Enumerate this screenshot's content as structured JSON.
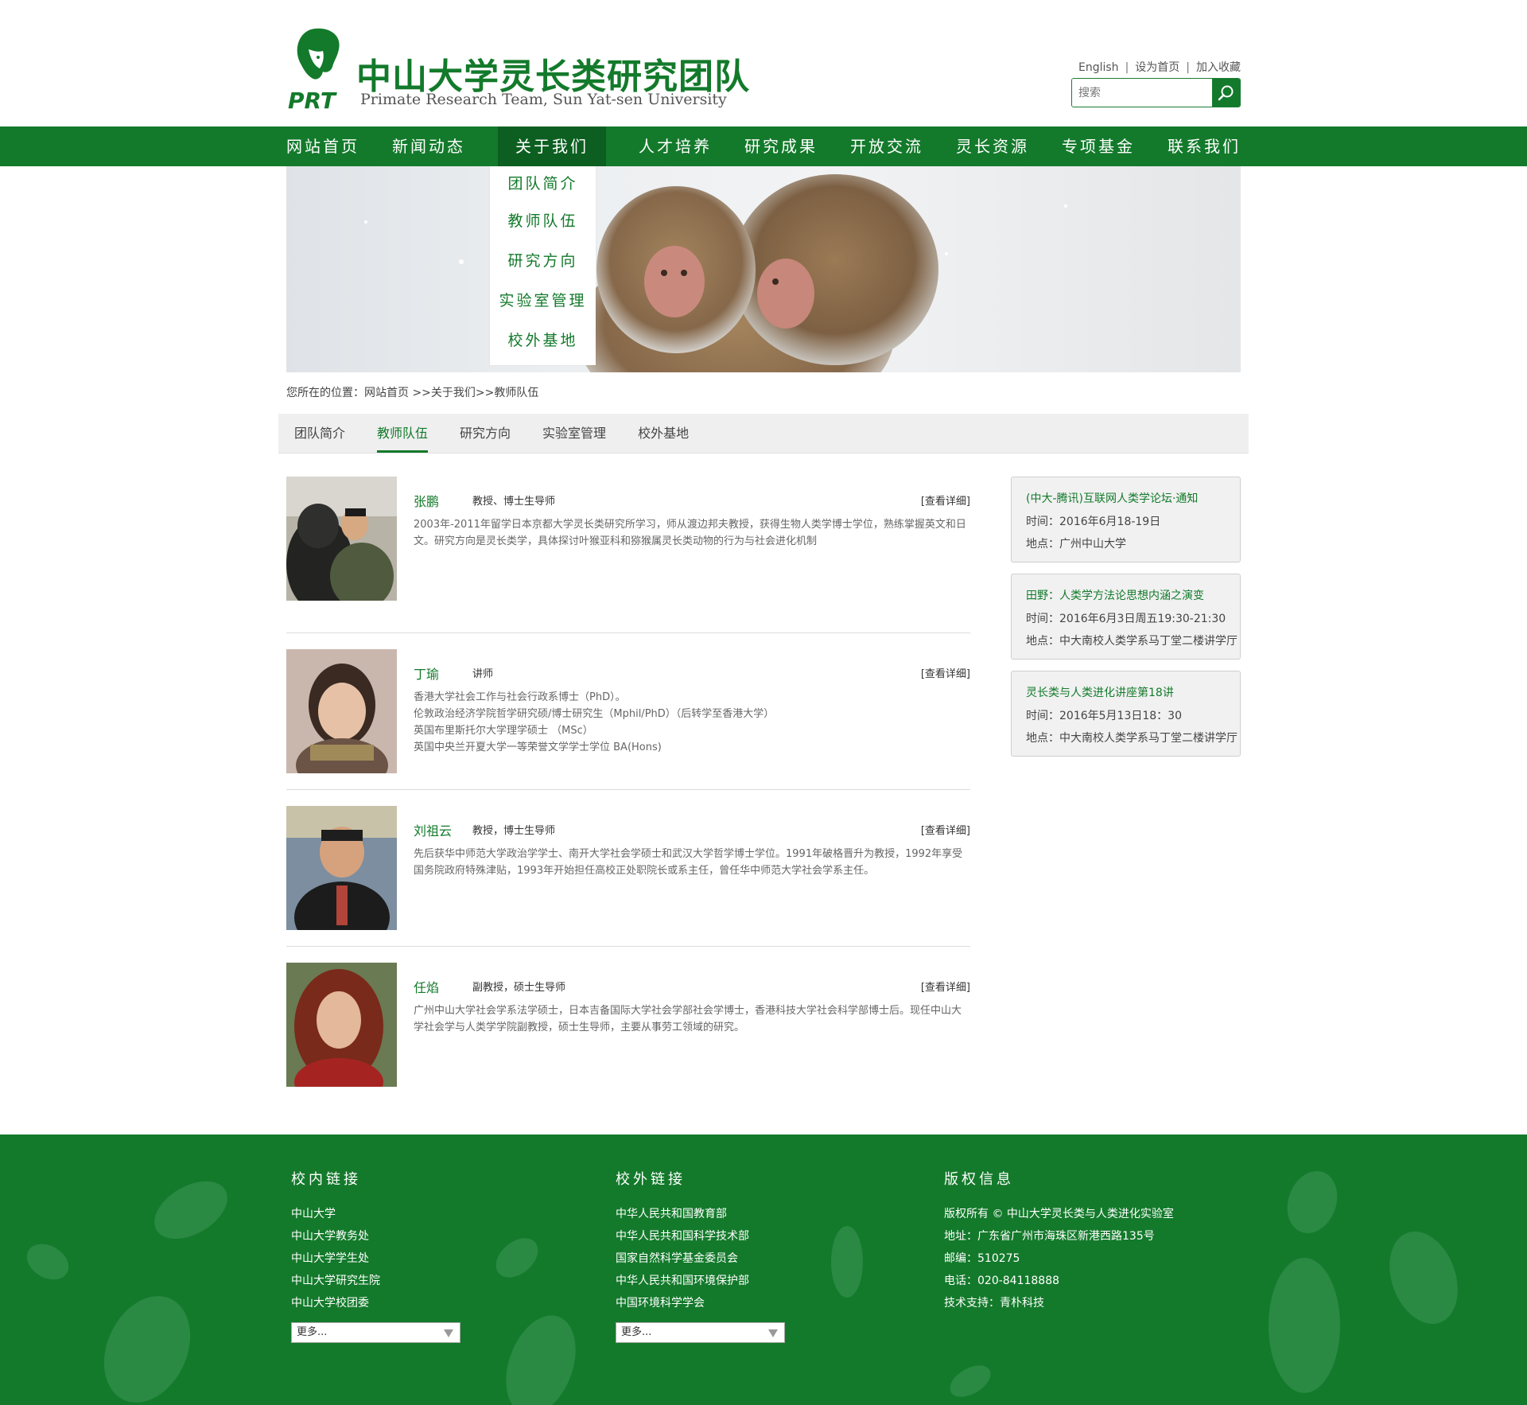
{
  "header": {
    "logo_text": "PRT",
    "title": "中山大学灵长类研究团队",
    "subtitle": "Primate Research Team, Sun Yat-sen University",
    "links": {
      "english": "English",
      "homepage": "设为首页",
      "favorite": "加入收藏"
    },
    "search_placeholder": "搜索"
  },
  "nav": {
    "items": [
      "网站首页",
      "新闻动态",
      "关于我们",
      "人才培养",
      "研究成果",
      "开放交流",
      "灵长资源",
      "专项基金",
      "联系我们"
    ],
    "active": "关于我们",
    "dropdown": [
      "团队简介",
      "教师队伍",
      "研究方向",
      "实验室管理",
      "校外基地"
    ]
  },
  "breadcrumb": "您所在的位置：网站首页 >>关于我们>>教师队伍",
  "subnav": {
    "items": [
      "团队简介",
      "教师队伍",
      "研究方向",
      "实验室管理",
      "校外基地"
    ],
    "active": "教师队伍"
  },
  "people": [
    {
      "name": "张鹏",
      "title": "教授、博士生导师",
      "more": "[查看详细]",
      "desc": [
        "2003年-2011年留学日本京都大学灵长类研究所学习，师从渡边邦夫教授，获得生物人类学博士学位，熟练掌握英文和日文。研究方向是灵长类学，具体探讨叶猴亚科和猕猴属灵长类动物的行为与社会进化机制"
      ]
    },
    {
      "name": "丁瑜",
      "title": "讲师",
      "more": "[查看详细]",
      "desc": [
        "香港大学社会工作与社会行政系博士（PhD）。",
        "伦敦政治经济学院哲学研究硕/博士研究生（Mphil/PhD）（后转学至香港大学）",
        "英国布里斯托尔大学理学硕士 （MSc）",
        "英国中央兰开夏大学一等荣誉文学学士学位 BA(Hons)"
      ]
    },
    {
      "name": "刘祖云",
      "title": "教授，博士生导师",
      "more": "[查看详细]",
      "desc": [
        "先后获华中师范大学政治学学士、南开大学社会学硕士和武汉大学哲学博士学位。1991年破格晋升为教授，1992年享受国务院政府特殊津贴，1993年开始担任高校正处职院长或系主任，曾任华中师范大学社会学系主任。"
      ]
    },
    {
      "name": "任焰",
      "title": "副教授，硕士生导师",
      "more": "[查看详细]",
      "desc": [
        "广州中山大学社会学系法学硕士，日本吉备国际大学社会学部社会学博士，香港科技大学社会科学部博士后。现任中山大学社会学与人类学学院副教授，硕士生导师，主要从事劳工领域的研究。"
      ]
    }
  ],
  "events": [
    {
      "title": "(中大-腾讯)互联网人类学论坛·通知",
      "time": "时间：2016年6月18-19日",
      "place": "地点：广州中山大学"
    },
    {
      "title": "田野：人类学方法论思想内涵之演变",
      "time": "时间：2016年6月3日周五19:30-21:30",
      "place": "地点：中大南校人类学系马丁堂二楼讲学厅"
    },
    {
      "title": "灵长类与人类进化讲座第18讲",
      "time": "时间：2016年5月13日18：30",
      "place": "地点：中大南校人类学系马丁堂二楼讲学厅"
    }
  ],
  "footer": {
    "internal": {
      "heading": "校内链接",
      "links": [
        "中山大学",
        "中山大学教务处",
        "中山大学学生处",
        "中山大学研究生院",
        "中山大学校团委"
      ],
      "more": "更多..."
    },
    "external": {
      "heading": "校外链接",
      "links": [
        "中华人民共和国教育部",
        "中华人民共和国科学技术部",
        "国家自然科学基金委员会",
        "中华人民共和国环境保护部",
        "中国环境科学学会"
      ],
      "more": "更多..."
    },
    "copyright": {
      "heading": "版权信息",
      "lines": [
        "版权所有 © 中山大学灵长类与人类进化实验室",
        "地址：广东省广州市海珠区新港西路135号",
        "邮编：510275",
        "电话：020-84118888",
        "技术支持：青朴科技"
      ]
    }
  },
  "colors": {
    "brand_green": "#137a2b",
    "dark_green": "#0c5f20",
    "footer_bg": "#137a2b"
  }
}
